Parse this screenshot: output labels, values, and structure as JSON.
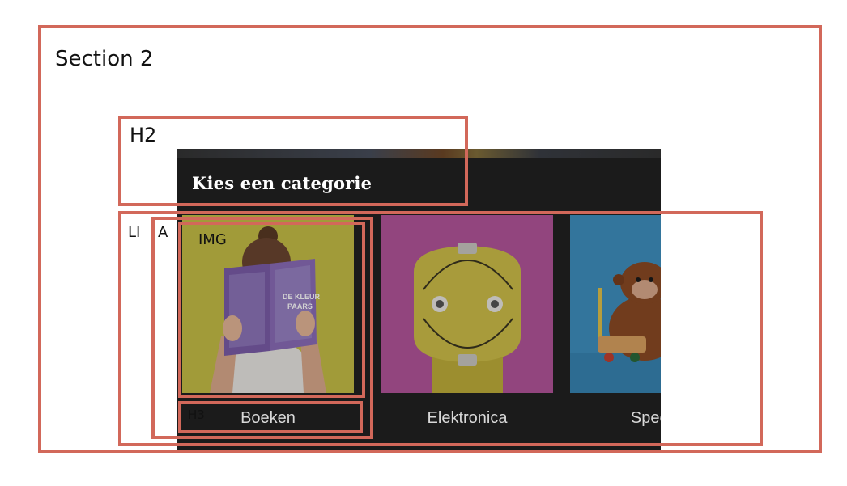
{
  "annotations": {
    "section": "Section 2",
    "h2": "H2",
    "li": "LI",
    "a": "A",
    "img": "IMG",
    "h3": "H3"
  },
  "screen": {
    "title": "Kies een categorie",
    "categories": [
      {
        "label": "Boeken",
        "image": "woman-reading-book"
      },
      {
        "label": "Elektronica",
        "image": "yellow-power-socket"
      },
      {
        "label": "Speelg",
        "image": "toy-monkey"
      }
    ],
    "book": {
      "line1": "DE KLEUR",
      "line2": "PAARS"
    }
  },
  "colors": {
    "annotation_border": "#d2685a",
    "screen_bg": "#1b1b1b",
    "tile1_bg": "#c9c24a",
    "tile2_bg": "#b2559a",
    "tile3_bg": "#3f8fbf"
  }
}
